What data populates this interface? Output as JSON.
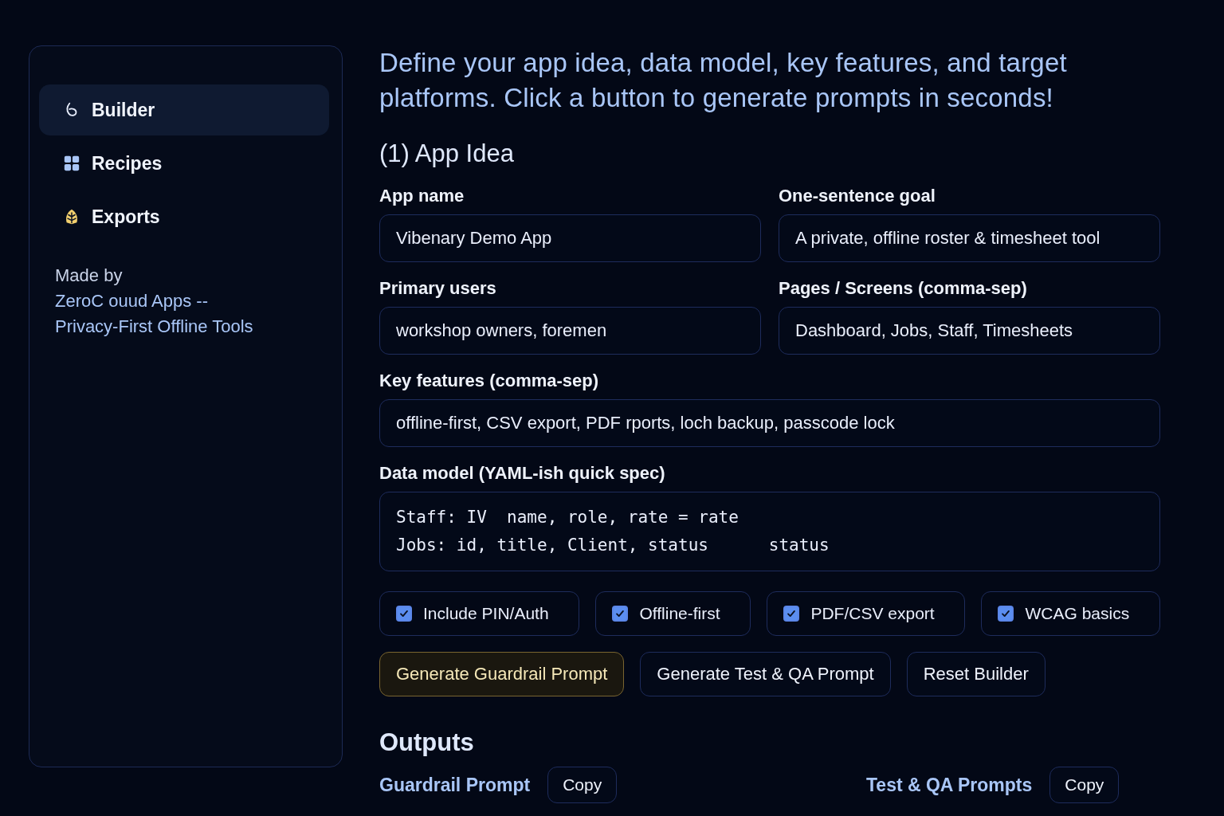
{
  "sidebar": {
    "items": [
      {
        "label": "Builder",
        "selected": true
      },
      {
        "label": "Recipes",
        "selected": false
      },
      {
        "label": "Exports",
        "selected": false
      }
    ],
    "credit": {
      "prefix": "Made by",
      "line_1": "ZeroC ouud Apps --",
      "line_2": "Privacy-First Offline Tools"
    }
  },
  "intro": "Define your app idea, data model, key features, and target platforms. Click a button to generate prompts in seconds!",
  "section_title": "(1) App Idea",
  "fields": [
    {
      "label": "App name",
      "value": "Vibenary Demo App"
    },
    {
      "label": "One-sentence goal",
      "value": "A private, offline roster & timesheet tool"
    },
    {
      "label": "Primary users",
      "value": "workshop owners, foremen"
    },
    {
      "label": "Pages / Screens (comma-sep)",
      "value": "Dashboard, Jobs, Staff, Timesheets"
    },
    {
      "label": "Key features (comma-sep)",
      "value": "offline-first, CSV export, PDF rports, loch backup, passcode lock"
    }
  ],
  "data_model": {
    "label": "Data model (YAML-ish quick spec)",
    "lines": [
      "Staff: IV  name, role, rate = rate",
      "Jobs: id, title, Client, status      status"
    ]
  },
  "options": [
    {
      "label": "Include PIN/Auth",
      "checked": true
    },
    {
      "label": "Offline-first",
      "checked": true
    },
    {
      "label": "PDF/CSV export",
      "checked": true
    },
    {
      "label": "WCAG basics",
      "checked": true
    }
  ],
  "actions": [
    {
      "label": "Generate Guardrail Prompt",
      "kind": "primary"
    },
    {
      "label": "Generate Test & QA Prompt",
      "kind": "secondary"
    },
    {
      "label": "Reset Builder",
      "kind": "secondary"
    }
  ],
  "outputs": {
    "title": "Outputs",
    "panels": [
      {
        "title": "Guardrail Prompt",
        "copy": "Copy"
      },
      {
        "title": "Test & QA Prompts",
        "copy": "Copy"
      }
    ]
  }
}
